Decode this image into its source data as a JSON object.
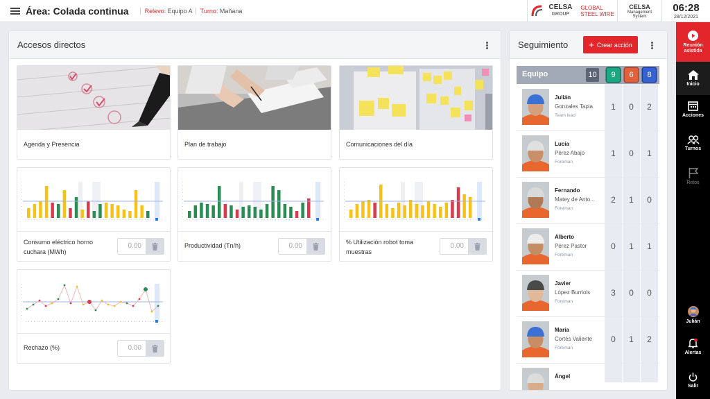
{
  "header": {
    "area_title": "Área: Colada continua",
    "relevo_key": "Relevo:",
    "relevo_value": "Equipo A",
    "turno_key": "Turno:",
    "turno_value": "Mañana",
    "celsa_name": "CELSA",
    "celsa_sub": "GROUP",
    "global_steel_line1": "GLOBAL",
    "global_steel_line2": "STEEL WIRE",
    "ms_name": "CELSA",
    "ms_line1": "Management",
    "ms_line2": "System",
    "time": "06:28",
    "date": "28/12/2021"
  },
  "accesos": {
    "title": "Accesos directos",
    "cards": [
      {
        "label": "Agenda y Presencia"
      },
      {
        "label": "Plan de trabajo"
      },
      {
        "label": "Comunicaciones del día"
      }
    ],
    "kpis": [
      {
        "label_line1": "Consumo eléctrico horno",
        "label_line2": "cuchara (MWh)",
        "value": "0.00"
      },
      {
        "label_line1": "Productividad (Tn/h)",
        "label_line2": "",
        "value": "0.00"
      },
      {
        "label_line1": "% Utilización robot toma",
        "label_line2": "muestras",
        "value": "0.00"
      },
      {
        "label_line1": "Rechazo (%)",
        "label_line2": "",
        "value": "0.00"
      }
    ]
  },
  "seguimiento": {
    "title": "Seguimiento",
    "crear_label": "Crear acción",
    "team_label": "Equipo",
    "counts": [
      "10",
      "9",
      "6",
      "8"
    ],
    "people": [
      {
        "name": "Julián",
        "surname": "Gonzales Tapia",
        "role": "Team lead",
        "n1": "1",
        "n2": "0",
        "n3": "2"
      },
      {
        "name": "Lucía",
        "surname": "Pérez Abajo",
        "role": "Foreman",
        "n1": "1",
        "n2": "0",
        "n3": "1"
      },
      {
        "name": "Fernando",
        "surname": "Matey de Anto...",
        "role": "Foreman",
        "n1": "2",
        "n2": "1",
        "n3": "0"
      },
      {
        "name": "Alberto",
        "surname": "Pérez Pastor",
        "role": "Foreman",
        "n1": "0",
        "n2": "1",
        "n3": "1"
      },
      {
        "name": "Javier",
        "surname": "López Burriols",
        "role": "Foreman",
        "n1": "3",
        "n2": "0",
        "n3": "0"
      },
      {
        "name": "María",
        "surname": "Cortés Valiente",
        "role": "Foreman",
        "n1": "0",
        "n2": "1",
        "n3": "2"
      },
      {
        "name": "Ángel",
        "surname": "",
        "role": "",
        "n1": "",
        "n2": "",
        "n3": ""
      }
    ]
  },
  "nav": {
    "reunion_line1": "Reunión",
    "reunion_line2": "asistida",
    "inicio": "Inicio",
    "acciones": "Acciones",
    "turnos": "Turnos",
    "retos": "Retos",
    "user": "Julián",
    "alertas": "Alertas",
    "salir": "Salir"
  },
  "colors": {
    "accent_red": "#e2262b",
    "count_gray": "#5d6575",
    "count_green": "#1aa884",
    "count_orange": "#e0613a",
    "count_blue": "#3461d4",
    "bar_yellow": "#f6c21a",
    "bar_green": "#2a8c52",
    "bar_red": "#d63b4e"
  }
}
